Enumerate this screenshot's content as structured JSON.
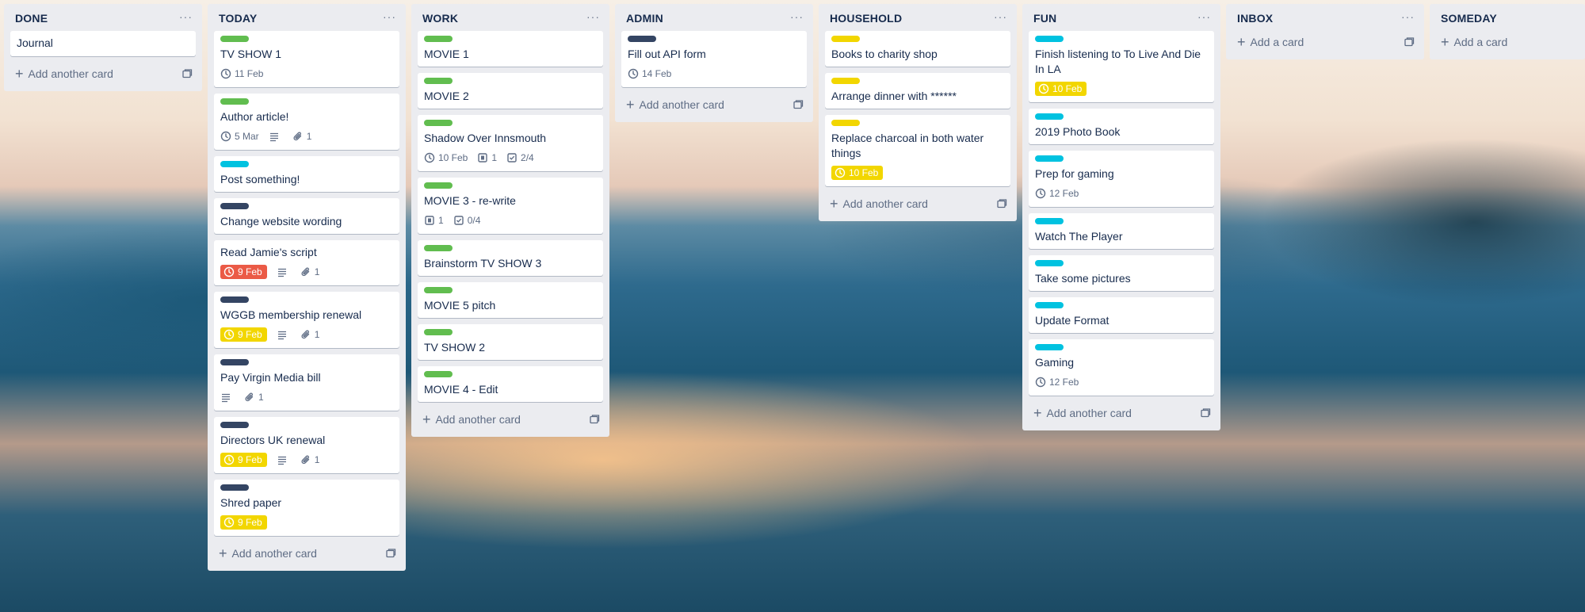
{
  "board": {
    "lists": [
      {
        "title": "DONE",
        "add_label": "Add another card",
        "cards": [
          {
            "title": "Journal"
          }
        ]
      },
      {
        "title": "TODAY",
        "add_label": "Add another card",
        "cards": [
          {
            "label": "green",
            "title": "TV SHOW 1",
            "due": "11 Feb"
          },
          {
            "label": "green",
            "title": "Author article!",
            "due": "5 Mar",
            "description": true,
            "attachments": "1"
          },
          {
            "label": "teal",
            "title": "Post something!"
          },
          {
            "label": "navy",
            "title": "Change website wording"
          },
          {
            "title": "Read Jamie's script",
            "due": "9 Feb",
            "due_status": "red",
            "description": true,
            "attachments": "1"
          },
          {
            "label": "navy",
            "title": "WGGB membership renewal",
            "due": "9 Feb",
            "due_status": "yellow",
            "description": true,
            "attachments": "1"
          },
          {
            "label": "navy",
            "title": "Pay Virgin Media bill",
            "description": true,
            "attachments": "1"
          },
          {
            "label": "navy",
            "title": "Directors UK renewal",
            "due": "9 Feb",
            "due_status": "yellow",
            "description": true,
            "attachments": "1"
          },
          {
            "label": "navy",
            "title": "Shred paper",
            "due": "9 Feb",
            "due_status": "yellow"
          }
        ]
      },
      {
        "title": "WORK",
        "add_label": "Add another card",
        "cards": [
          {
            "label": "green",
            "title": "MOVIE 1"
          },
          {
            "label": "green",
            "title": "MOVIE 2"
          },
          {
            "label": "green",
            "title": "Shadow Over Innsmouth",
            "due": "10 Feb",
            "files": "1",
            "checklist": "2/4"
          },
          {
            "label": "green",
            "title": "MOVIE 3 - re-write",
            "files": "1",
            "checklist": "0/4"
          },
          {
            "label": "green",
            "title": "Brainstorm TV SHOW 3"
          },
          {
            "label": "green",
            "title": "MOVIE 5 pitch"
          },
          {
            "label": "green",
            "title": "TV SHOW 2"
          },
          {
            "label": "green",
            "title": "MOVIE 4 - Edit"
          }
        ]
      },
      {
        "title": "ADMIN",
        "add_label": "Add another card",
        "cards": [
          {
            "label": "navy",
            "title": "Fill out API form",
            "due": "14 Feb"
          }
        ]
      },
      {
        "title": "HOUSEHOLD",
        "add_label": "Add another card",
        "cards": [
          {
            "label": "yellow",
            "title": "Books to charity shop"
          },
          {
            "label": "yellow",
            "title": "Arrange dinner with ******"
          },
          {
            "label": "yellow",
            "title": "Replace charcoal in both water things",
            "due": "10 Feb",
            "due_status": "yellow"
          }
        ]
      },
      {
        "title": "FUN",
        "add_label": "Add another card",
        "cards": [
          {
            "label": "teal",
            "title": "Finish listening to To Live And Die In LA",
            "due": "10 Feb",
            "due_status": "yellow"
          },
          {
            "label": "teal",
            "title": "2019 Photo Book"
          },
          {
            "label": "teal",
            "title": "Prep for gaming",
            "due": "12 Feb"
          },
          {
            "label": "teal",
            "title": "Watch The Player"
          },
          {
            "label": "teal",
            "title": "Take some pictures"
          },
          {
            "label": "teal",
            "title": "Update Format"
          },
          {
            "label": "teal",
            "title": "Gaming",
            "due": "12 Feb"
          }
        ]
      },
      {
        "title": "INBOX",
        "add_label": "Add a card",
        "cards": []
      },
      {
        "title": "SOMEDAY",
        "add_label": "Add a card",
        "cards": []
      }
    ]
  },
  "colors": {
    "green": "#61bd4f",
    "teal": "#00c2e0",
    "navy": "#344563",
    "yellow": "#f2d600",
    "red": "#eb5a46",
    "list_bg": "#ebecf0"
  }
}
